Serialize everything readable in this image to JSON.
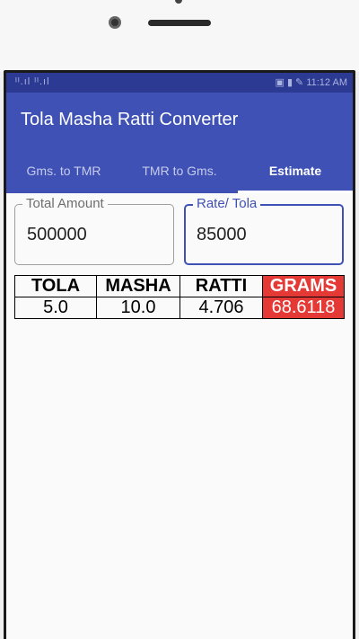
{
  "status_bar": {
    "signal_text": "ᴵᴵ.ıl ᴵᴵ.ıl",
    "right_text": "▣ ▮ ✎ 11:12 AM"
  },
  "app": {
    "title": "Tola Masha Ratti Converter"
  },
  "tabs": [
    {
      "label": "Gms. to TMR"
    },
    {
      "label": "TMR to Gms."
    },
    {
      "label": "Estimate"
    }
  ],
  "form": {
    "total_amount": {
      "label": "Total Amount",
      "value": "500000"
    },
    "rate_tola": {
      "label": "Rate/ Tola",
      "value": "85000"
    }
  },
  "results": {
    "headers": [
      "TOLA",
      "MASHA",
      "RATTI",
      "GRAMS"
    ],
    "values": [
      "5.0",
      "10.0",
      "4.706",
      "68.6118"
    ]
  },
  "colors": {
    "primary": "#3f51b5",
    "primary_dark": "#2c3a93",
    "grams_highlight": "#e53935"
  }
}
